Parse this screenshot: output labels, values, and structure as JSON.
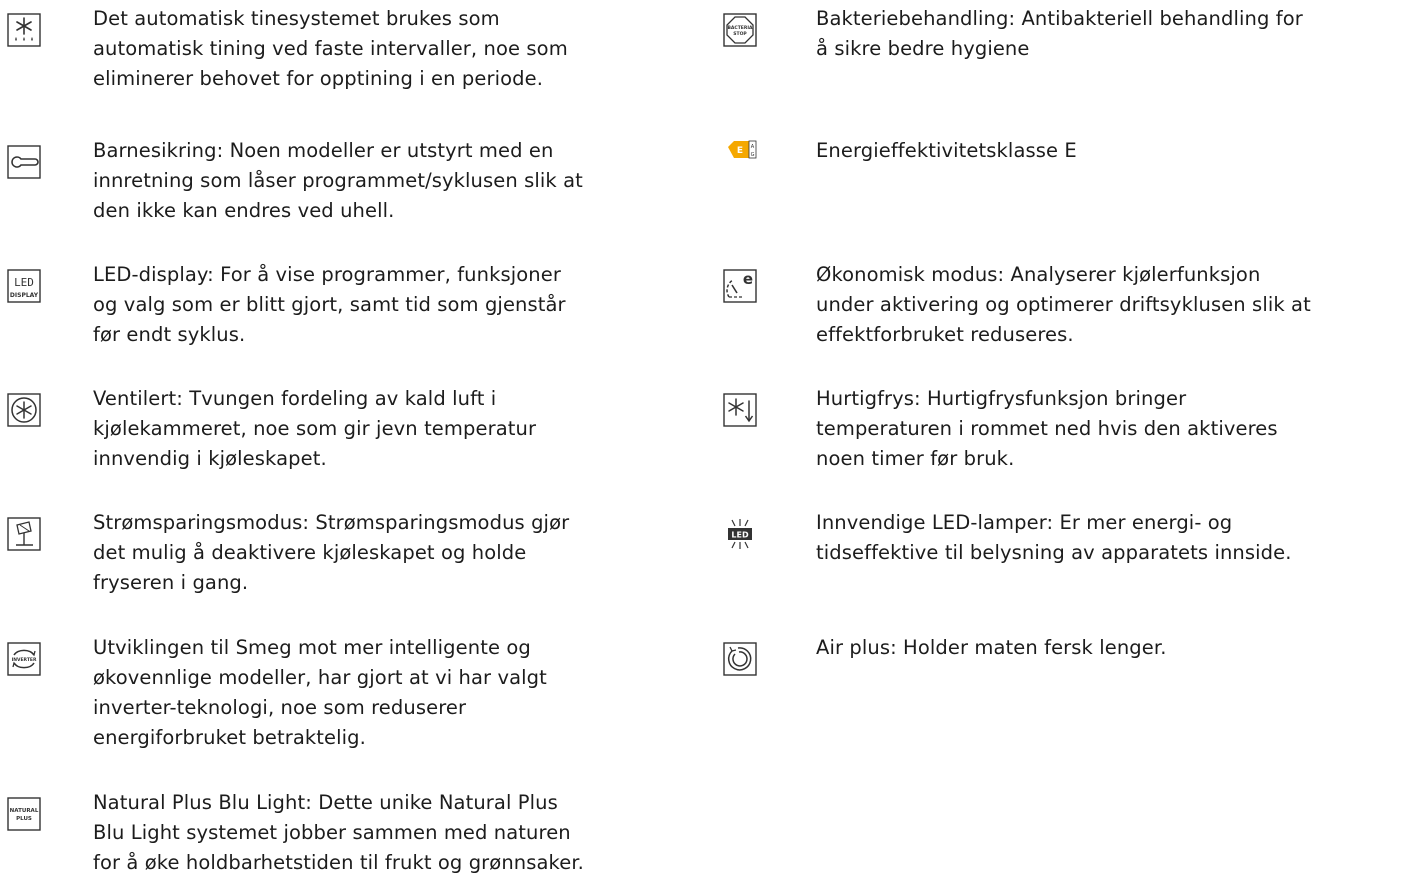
{
  "left_features": [
    {
      "icon": "auto-defrost-icon",
      "lines": [
        "Det automatisk tinesystemet brukes som",
        "automatisk tining ved faste intervaller, noe som",
        "eliminerer behovet for opptining i en periode."
      ]
    },
    {
      "icon": "child-lock-icon",
      "lines": [
        "Barnesikring: Noen modeller er utstyrt med en",
        "innretning som låser programmet/syklusen slik at",
        "den ikke kan endres ved uhell."
      ]
    },
    {
      "icon": "led-display-icon",
      "icon_text": [
        "LED",
        "DISPLAY"
      ],
      "lines": [
        "LED-display: For å vise programmer, funksjoner",
        "og valg som er blitt gjort, samt tid som gjenstår",
        "før endt syklus."
      ]
    },
    {
      "icon": "ventilated-fan-icon",
      "lines": [
        "Ventilert: Tvungen fordeling av kald luft i",
        "kjølekammeret, noe som gir jevn temperatur",
        "innvendig i kjøleskapet."
      ]
    },
    {
      "icon": "power-saving-icon",
      "lines": [
        "Strømsparingsmodus: Strømsparingsmodus gjør",
        "det mulig å deaktivere kjøleskapet og holde",
        "fryseren i gang."
      ]
    },
    {
      "icon": "inverter-icon",
      "icon_text": [
        "INVERTER"
      ],
      "lines": [
        "Utviklingen til Smeg mot mer intelligente og",
        "økovennlige modeller, har gjort at vi har valgt",
        "inverter-teknologi, noe som reduserer",
        "energiforbruket betraktelig."
      ]
    },
    {
      "icon": "natural-plus-icon",
      "icon_text": [
        "NATURAL",
        "PLUS"
      ],
      "lines": [
        "Natural Plus Blu Light: Dette unike Natural Plus",
        "Blu Light systemet jobber sammen med naturen",
        "for å øke holdbarhetstiden til frukt og grønnsaker."
      ]
    }
  ],
  "right_features": [
    {
      "icon": "bacteria-stop-icon",
      "icon_text": [
        "BACTERIA",
        "STOP"
      ],
      "lines": [
        "Bakteriebehandling: Antibakteriell behandling for",
        "å sikre bedre hygiene"
      ]
    },
    {
      "icon": "energy-class-icon",
      "icon_text": [
        "E",
        "A",
        "G"
      ],
      "lines": [
        "Energieffektivitetsklasse E"
      ]
    },
    {
      "icon": "eco-mode-icon",
      "icon_text": [
        "e"
      ],
      "lines": [
        "Økonomisk modus: Analyserer kjølerfunksjon",
        "under aktivering og optimerer driftsyklusen slik at",
        "effektforbruket reduseres."
      ]
    },
    {
      "icon": "fast-freeze-icon",
      "lines": [
        "Hurtigfrys: Hurtigfrysfunksjon bringer",
        "temperaturen i rommet ned hvis den aktiveres",
        "noen timer før bruk."
      ]
    },
    {
      "icon": "interior-led-lamps-icon",
      "icon_text": [
        "LED"
      ],
      "lines": [
        "Innvendige LED-lamper: Er mer energi- og",
        "tidseffektive til belysning av apparatets innside."
      ]
    },
    {
      "icon": "air-plus-icon",
      "lines": [
        "Air plus: Holder maten fersk lenger."
      ]
    }
  ],
  "colors": {
    "text": "#1c1c1c",
    "icon_stroke": "#333333",
    "energy_class_badge": "#f5a800"
  }
}
